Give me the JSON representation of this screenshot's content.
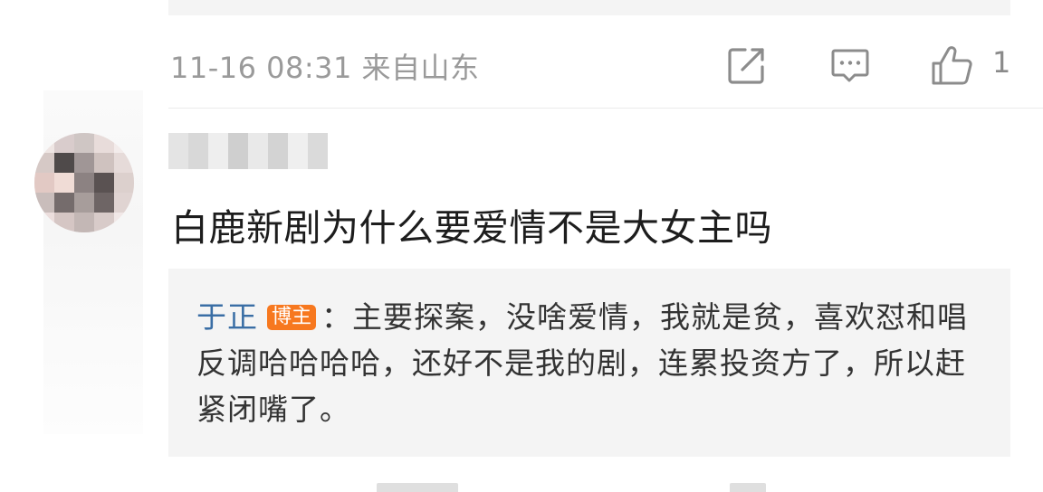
{
  "previous_post": {
    "meta": {
      "timestamp": "11-16 08:31",
      "location": "来自山东",
      "share_icon": "share-edit-icon",
      "comment_icon": "comment-icon",
      "like_icon": "thumbs-up-icon",
      "like_count": "1"
    }
  },
  "comment": {
    "text": "白鹿新剧为什么要爱情不是大女主吗",
    "username_obscured": true,
    "avatar_obscured": true,
    "reply": {
      "author": "于正",
      "badge": "博主",
      "separator": "：",
      "text": "主要探案，没啥爱情，我就是贫，喜欢怼和唱反调哈哈哈哈，还好不是我的剧，连累投资方了，所以赶紧闭嘴了。"
    }
  },
  "colors": {
    "meta_gray": "#9a9a9a",
    "author_blue": "#3a6ea5",
    "badge_orange": "#f7781f",
    "quote_bg": "#f4f4f4"
  }
}
